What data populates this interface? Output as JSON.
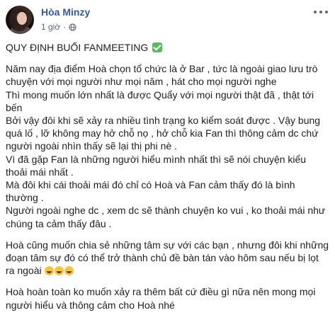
{
  "header": {
    "name": "Hòa Minzy",
    "time": "1 giờ",
    "dot": "·",
    "privacy_icon": "globe-icon",
    "more_icon": "more-icon"
  },
  "colors": {
    "name": "#385898",
    "text": "#1c1e21",
    "meta": "#606770"
  },
  "post": {
    "title": "QUY ĐỊNH BUỔI FANMEETING",
    "title_icon": "check-icon",
    "block1": [
      "Năm nay địa điểm Hoà chọn tổ chức là ở Bar , tức là ngoài giao lưu trò chuyện với mọi người như mọi năm , hát cho mọi người nghe",
      "Thì mong muốn lớn nhất là được Quẩy với mọi người thật đã , thật tới bến",
      "Bởi vậy đôi khi sẽ xảy ra nhiều tình trạng ko kiểm soát được . Vậy bung quá lố , lỡ không may hở chỗ nọ , hở chỗ kia Fan thì thông cảm dc chứ người ngoài nhìn thấy sẽ lại thị phi nè .",
      "Vì đã gặp Fan là những người hiểu mình nhất thì sẽ nói chuyện kiểu thoải mái nhất .",
      "Mà đôi khi cái thoải mái đó chỉ có Hoà và Fan cảm thấy đó là bình thường .",
      "Người ngoài nghe dc , xem dc sẽ thành chuyện ko vui , ko thoải mái như chúng ta cảm thấy đâu ."
    ],
    "block2": "Hoà cũng muốn chia sẻ những tâm sự với các bạn , nhưng đôi khi những đoạn tâm sự đó có thể trở thành chủ đề bàn tán vào hôm sau nếu bị lọt ra ngoài",
    "block2_emoji": "grinning-squint-face",
    "block3": "Hoà hoàn toàn ko muốn xảy ra thêm bất cứ điều gì nữa nên mong mọi người hiểu và thông cảm cho Hoà nhé"
  }
}
